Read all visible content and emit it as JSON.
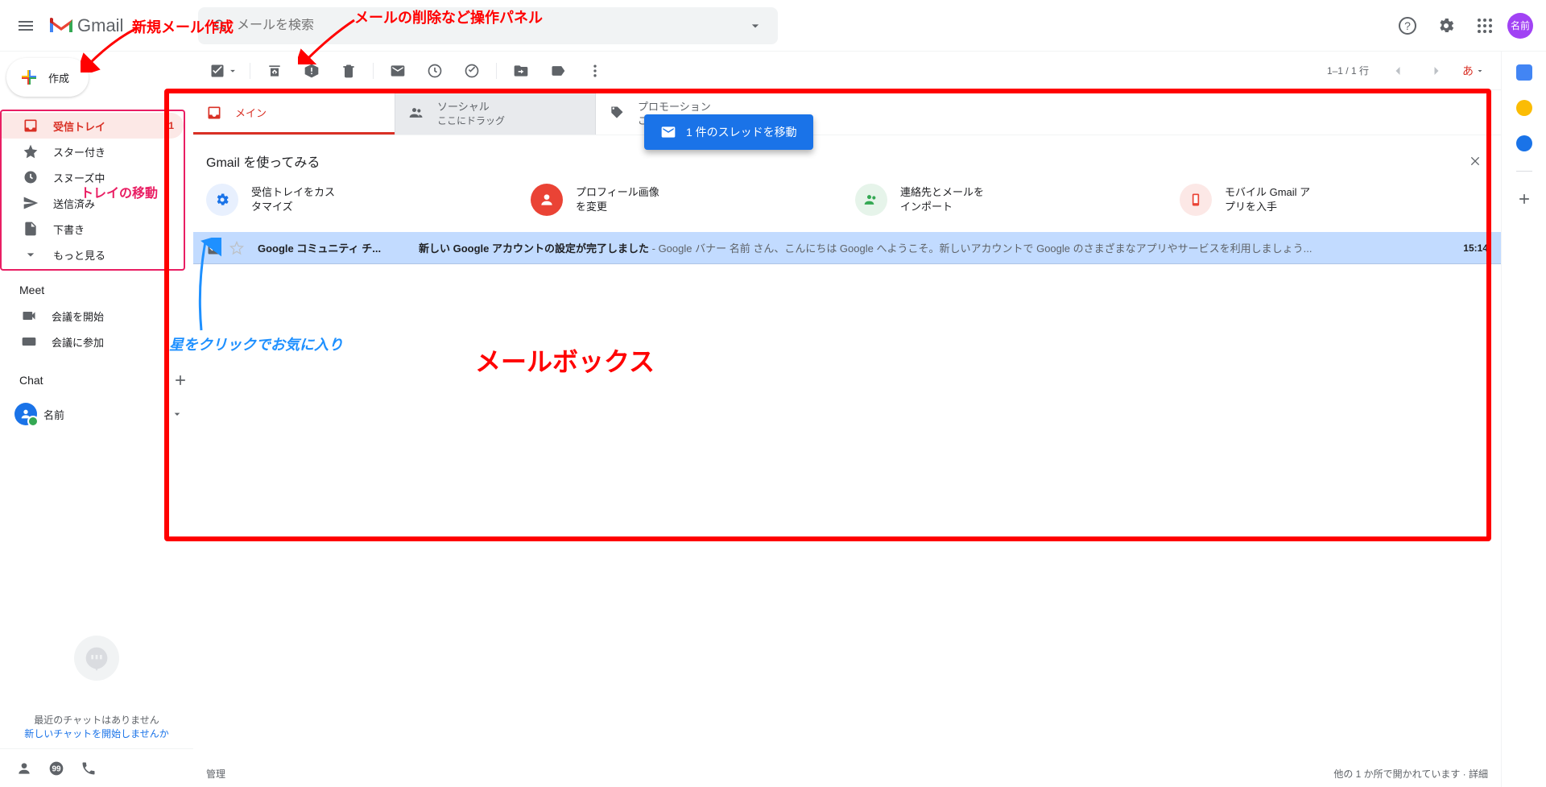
{
  "header": {
    "logo_text": "Gmail",
    "search_placeholder": "メールを検索",
    "avatar_label": "名前"
  },
  "compose_label": "作成",
  "sidebar": {
    "items": [
      {
        "label": "受信トレイ",
        "count": "1"
      },
      {
        "label": "スター付き"
      },
      {
        "label": "スヌーズ中"
      },
      {
        "label": "送信済み"
      },
      {
        "label": "下書き"
      },
      {
        "label": "もっと見る"
      }
    ],
    "meet_title": "Meet",
    "meet_items": [
      "会議を開始",
      "会議に参加"
    ],
    "chat_title": "Chat",
    "chat_user": "名前",
    "no_chats": "最近のチャットはありません",
    "new_chat": "新しいチャットを開始しませんか"
  },
  "toolbar": {
    "page_info": "1–1 / 1 行",
    "lang": "あ"
  },
  "tabs": [
    {
      "label": "メイン"
    },
    {
      "label": "ソーシャル",
      "sub": "ここにドラッグ"
    },
    {
      "label": "プロモーション",
      "sub": "ここにドラッグ"
    }
  ],
  "drag_badge": "1 件のスレッドを移動",
  "getting_started": {
    "title": "Gmail を使ってみる",
    "cards": [
      {
        "line1": "受信トレイをカス",
        "line2": "タマイズ"
      },
      {
        "line1": "プロフィール画像",
        "line2": "を変更"
      },
      {
        "line1": "連絡先とメールを",
        "line2": "インポート"
      },
      {
        "line1": "モバイル Gmail ア",
        "line2": "プリを入手"
      }
    ]
  },
  "mail": {
    "sender": "Google コミュニティ チ...",
    "subject": "新しい Google アカウントの設定が完了しました",
    "snippet": " - Google バナー 名前 さん、こんにちは Google へようこそ。新しいアカウントで Google のさまざまなアプリやサービスを利用しましょう...",
    "time": "15:14"
  },
  "footer": {
    "left": "管理",
    "right": "他の 1 か所で開かれています · 詳細"
  },
  "annotations": {
    "compose_anno": "新規メール作成",
    "toolbar_anno": "メールの削除など操作パネル",
    "tray_move": "トレイの移動",
    "star_anno": "星をクリックでお気に入り",
    "mailbox_anno": "メールボックス"
  }
}
